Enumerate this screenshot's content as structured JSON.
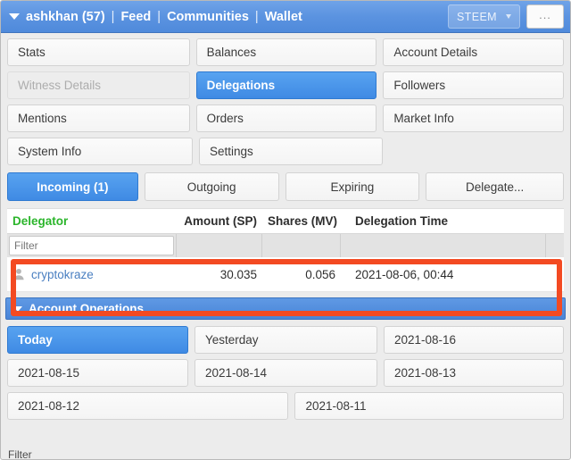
{
  "header": {
    "user": "ashkhan (57)",
    "separator": "|",
    "links": [
      "Feed",
      "Communities",
      "Wallet"
    ],
    "currency_label": "STEEM",
    "more_button": "...",
    "caret_icon": "caret-down-icon"
  },
  "main_nav": {
    "rows": [
      [
        {
          "label": "Stats",
          "state": "normal"
        },
        {
          "label": "Balances",
          "state": "normal"
        },
        {
          "label": "Account Details",
          "state": "normal"
        }
      ],
      [
        {
          "label": "Witness Details",
          "state": "disabled"
        },
        {
          "label": "Delegations",
          "state": "active"
        },
        {
          "label": "Followers",
          "state": "normal"
        }
      ],
      [
        {
          "label": "Mentions",
          "state": "normal"
        },
        {
          "label": "Orders",
          "state": "normal"
        },
        {
          "label": "Market Info",
          "state": "normal"
        }
      ],
      [
        {
          "label": "System Info",
          "state": "normal"
        },
        {
          "label": "Settings",
          "state": "normal"
        }
      ]
    ]
  },
  "sub_tabs": [
    {
      "label": "Incoming (1)",
      "state": "active"
    },
    {
      "label": "Outgoing",
      "state": "normal"
    },
    {
      "label": "Expiring",
      "state": "normal"
    },
    {
      "label": "Delegate...",
      "state": "normal"
    }
  ],
  "table": {
    "columns": [
      {
        "label": "Delegator",
        "sorted": true
      },
      {
        "label": "Amount (SP)",
        "sorted": false
      },
      {
        "label": "Shares (MV)",
        "sorted": false
      },
      {
        "label": "Delegation Time",
        "sorted": false
      }
    ],
    "filter_placeholder": "Filter",
    "filter_value": "",
    "rows": [
      {
        "delegator": "cryptokraze",
        "avatar_icon": "person-icon",
        "amount_sp": "30.035",
        "shares_mv": "0.056",
        "delegation_time": "2021-08-06, 00:44"
      }
    ]
  },
  "highlight": {
    "color": "#f34a22",
    "target": "delegation-row"
  },
  "account_operations": {
    "title": "Account Operations",
    "caret_icon": "caret-down-icon",
    "date_rows": [
      [
        {
          "label": "Today",
          "state": "active"
        },
        {
          "label": "Yesterday",
          "state": "normal"
        },
        {
          "label": "2021-08-16",
          "state": "normal"
        }
      ],
      [
        {
          "label": "2021-08-15",
          "state": "normal"
        },
        {
          "label": "2021-08-14",
          "state": "normal"
        },
        {
          "label": "2021-08-13",
          "state": "normal"
        }
      ],
      [
        {
          "label": "2021-08-12",
          "state": "normal"
        },
        {
          "label": "2021-08-11",
          "state": "normal"
        }
      ]
    ],
    "bottom_filter_placeholder": "Filter"
  },
  "colors": {
    "accent_blue": "#3f8ae4",
    "header_blue": "#5b93e0",
    "sorted_green": "#2bb52b",
    "link_blue": "#4a7fc1",
    "highlight_red": "#f34a22"
  }
}
